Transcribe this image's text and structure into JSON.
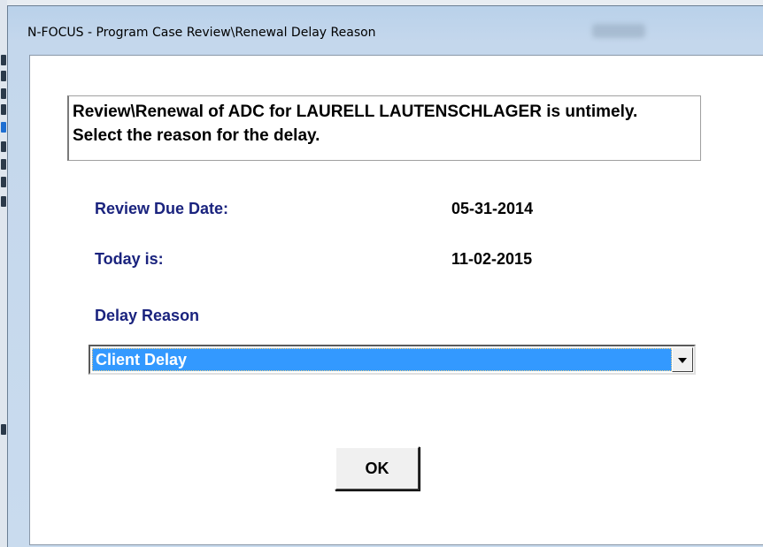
{
  "window": {
    "title": "N-FOCUS - Program Case Review\\Renewal Delay Reason"
  },
  "dialog": {
    "message": "Review\\Renewal of ADC for LAURELL LAUTENSCHLAGER is untimely.  Select the reason for the delay.",
    "review_due_date_label": "Review Due Date:",
    "review_due_date_value": "05-31-2014",
    "today_label": "Today is:",
    "today_value": "11-02-2015",
    "delay_reason_label": "Delay Reason",
    "delay_reason_selected": "Client Delay",
    "ok_label": "OK"
  },
  "colors": {
    "label_text": "#1a237e",
    "selection_highlight": "#3399ff"
  },
  "icons": {
    "dropdown": "chevron-down-icon"
  }
}
